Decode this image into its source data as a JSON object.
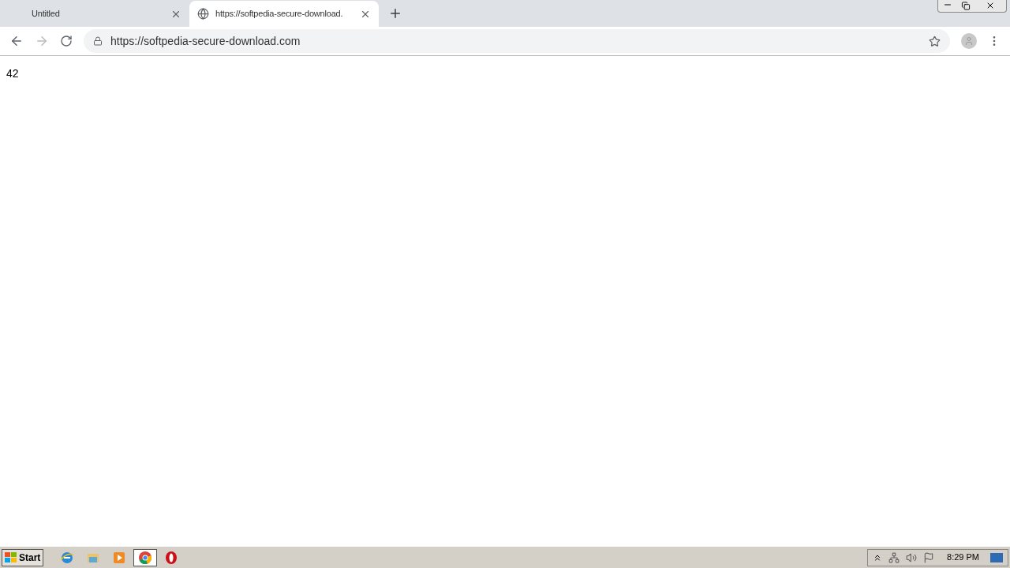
{
  "tabs": [
    {
      "title": "Untitled",
      "selected": false,
      "favicon": false
    },
    {
      "title": "https://softpedia-secure-download.",
      "selected": true,
      "favicon": true
    }
  ],
  "address": "https://softpedia-secure-download.com",
  "page_text": "42",
  "taskbar": {
    "start": "Start",
    "apps": [
      {
        "kind": "ie",
        "selected": false
      },
      {
        "kind": "explorer",
        "selected": false
      },
      {
        "kind": "media",
        "selected": false
      },
      {
        "kind": "chrome",
        "selected": true
      },
      {
        "kind": "opera",
        "selected": false
      }
    ],
    "clock": "8:29 PM"
  }
}
